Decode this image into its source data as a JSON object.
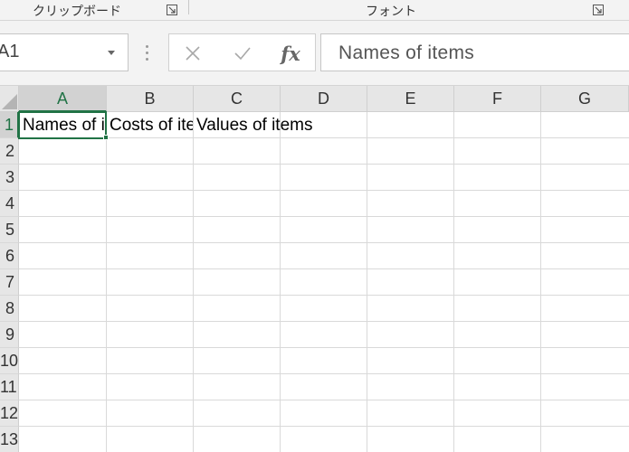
{
  "ribbon": {
    "groups": [
      {
        "label": "クリップボード"
      },
      {
        "label": "フォント"
      }
    ]
  },
  "formula_bar": {
    "name_box_value": "A1",
    "cancel_icon": "close-icon",
    "enter_icon": "checkmark-icon",
    "function_label": "fx",
    "formula_value": "Names of items"
  },
  "sheet": {
    "columns": [
      "A",
      "B",
      "C",
      "D",
      "E",
      "F",
      "G"
    ],
    "selected_column": "A",
    "rows": [
      "1",
      "2",
      "3",
      "4",
      "5",
      "6",
      "7",
      "8",
      "9",
      "10",
      "11",
      "12",
      "13"
    ],
    "selected_row": "1",
    "cells": {
      "A1": "Names of items",
      "B1": "Costs of items",
      "C1": "Values of items"
    },
    "accent_color": "#217346"
  }
}
